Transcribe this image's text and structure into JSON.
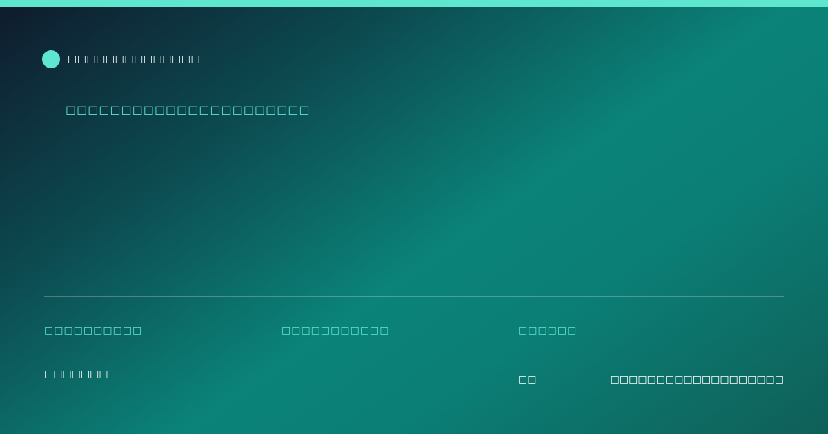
{
  "brand": {
    "name": "□□□□□□□□□□□□□□",
    "accent_color": "#5ee6cf"
  },
  "tagline": "□□□□□□□□□□□□□□□□□□□□□□",
  "columns": [
    {
      "label": "□□□□□□□□□□",
      "value": "□□□□□□□"
    },
    {
      "label": "□□□□□□□□□□□",
      "value": ""
    },
    {
      "label": "□□□□□□",
      "value": "□□"
    }
  ],
  "footer_right": "□□□□□□□□□□□□□□□□□□□"
}
